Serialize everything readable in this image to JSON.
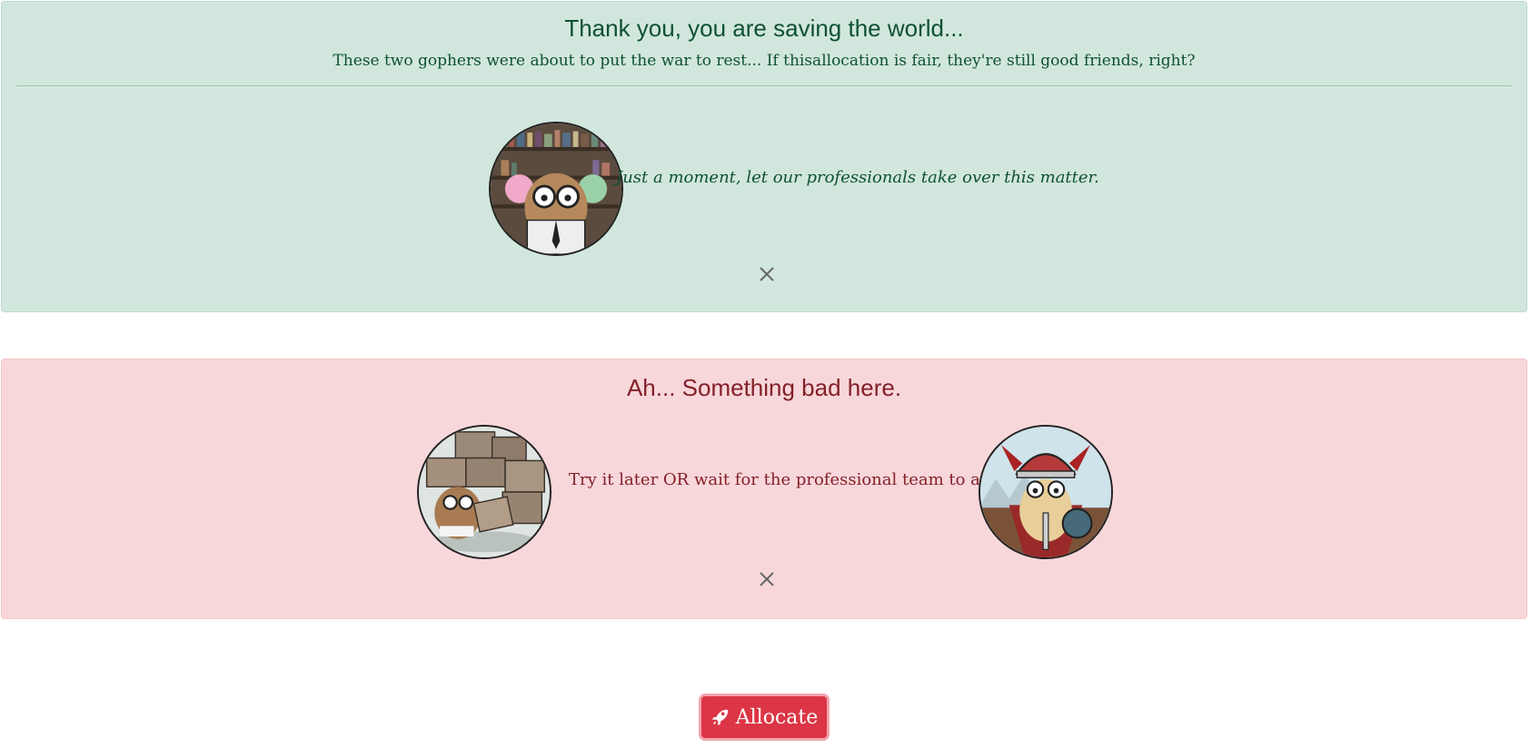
{
  "success_alert": {
    "title": "Thank you, you are saving the world...",
    "subtitle": "These two gophers were about to put the war to rest... If thisallocation is fair, they're still good friends, right?",
    "message": "Just a moment, let our professionals take over this matter.",
    "image_icon": "gopher-librarian-illustration",
    "close_icon": "close-icon"
  },
  "danger_alert": {
    "title": "Ah... Something bad here.",
    "message": "Try it later OR wait for the professional team to arrive.",
    "left_image_icon": "gopher-boxes-illustration",
    "right_image_icon": "gopher-viking-illustration",
    "close_icon": "close-icon"
  },
  "allocate_button": {
    "label": "Allocate",
    "icon": "rocket-icon"
  },
  "colors": {
    "success_bg": "#d1e7dd",
    "success_text": "#0f5132",
    "danger_bg": "#f8d7da",
    "danger_text": "#842029",
    "button_bg": "#dc3545"
  }
}
